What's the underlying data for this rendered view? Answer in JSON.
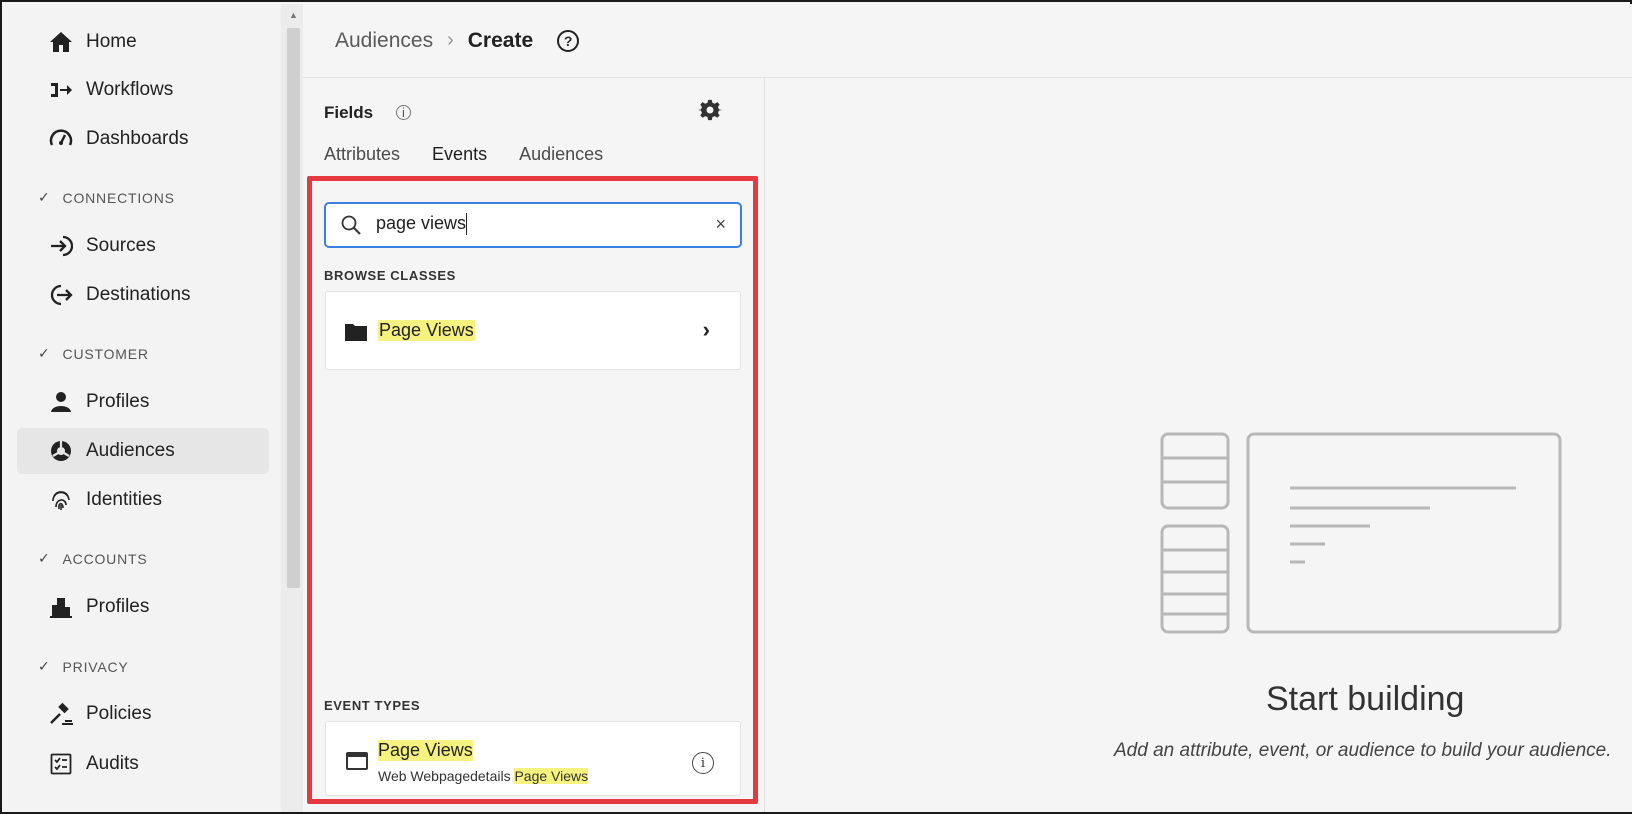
{
  "sidebar": {
    "items": [
      {
        "label": "Home",
        "icon": "home-icon"
      },
      {
        "label": "Workflows",
        "icon": "workflows-icon"
      },
      {
        "label": "Dashboards",
        "icon": "dashboards-icon"
      },
      {
        "label": "Sources",
        "icon": "sources-icon"
      },
      {
        "label": "Destinations",
        "icon": "destinations-icon"
      },
      {
        "label": "Profiles",
        "icon": "person-icon"
      },
      {
        "label": "Audiences",
        "icon": "audiences-icon"
      },
      {
        "label": "Identities",
        "icon": "fingerprint-icon"
      },
      {
        "label": "Profiles",
        "icon": "building-icon"
      },
      {
        "label": "Policies",
        "icon": "gavel-icon"
      },
      {
        "label": "Audits",
        "icon": "checklist-icon"
      }
    ],
    "sections": [
      "CONNECTIONS",
      "CUSTOMER",
      "ACCOUNTS",
      "PRIVACY"
    ],
    "active": "Audiences"
  },
  "header": {
    "breadcrumb_parent": "Audiences",
    "separator": "›",
    "breadcrumb_current": "Create",
    "help": "?"
  },
  "fields": {
    "title": "Fields",
    "info": "i",
    "tabs": [
      "Attributes",
      "Events",
      "Audiences"
    ],
    "selected_tab": "Events",
    "search": {
      "value": "page views",
      "clear": "×"
    },
    "browse_label": "BROWSE CLASSES",
    "class_item": {
      "name": "Page Views",
      "chevron": "›"
    },
    "event_types_label": "EVENT TYPES",
    "event_item": {
      "title": "Page Views",
      "subtitle_prefix": "Web Webpagedetails ",
      "subtitle_match": "Page Views",
      "info": "i"
    }
  },
  "canvas": {
    "title": "Start building",
    "subtitle": "Add an attribute, event, or audience to build your audience."
  },
  "colors": {
    "highlight_border": "#e6393f",
    "search_focus": "#3b7fe0",
    "match_highlight": "#f6f27f"
  }
}
